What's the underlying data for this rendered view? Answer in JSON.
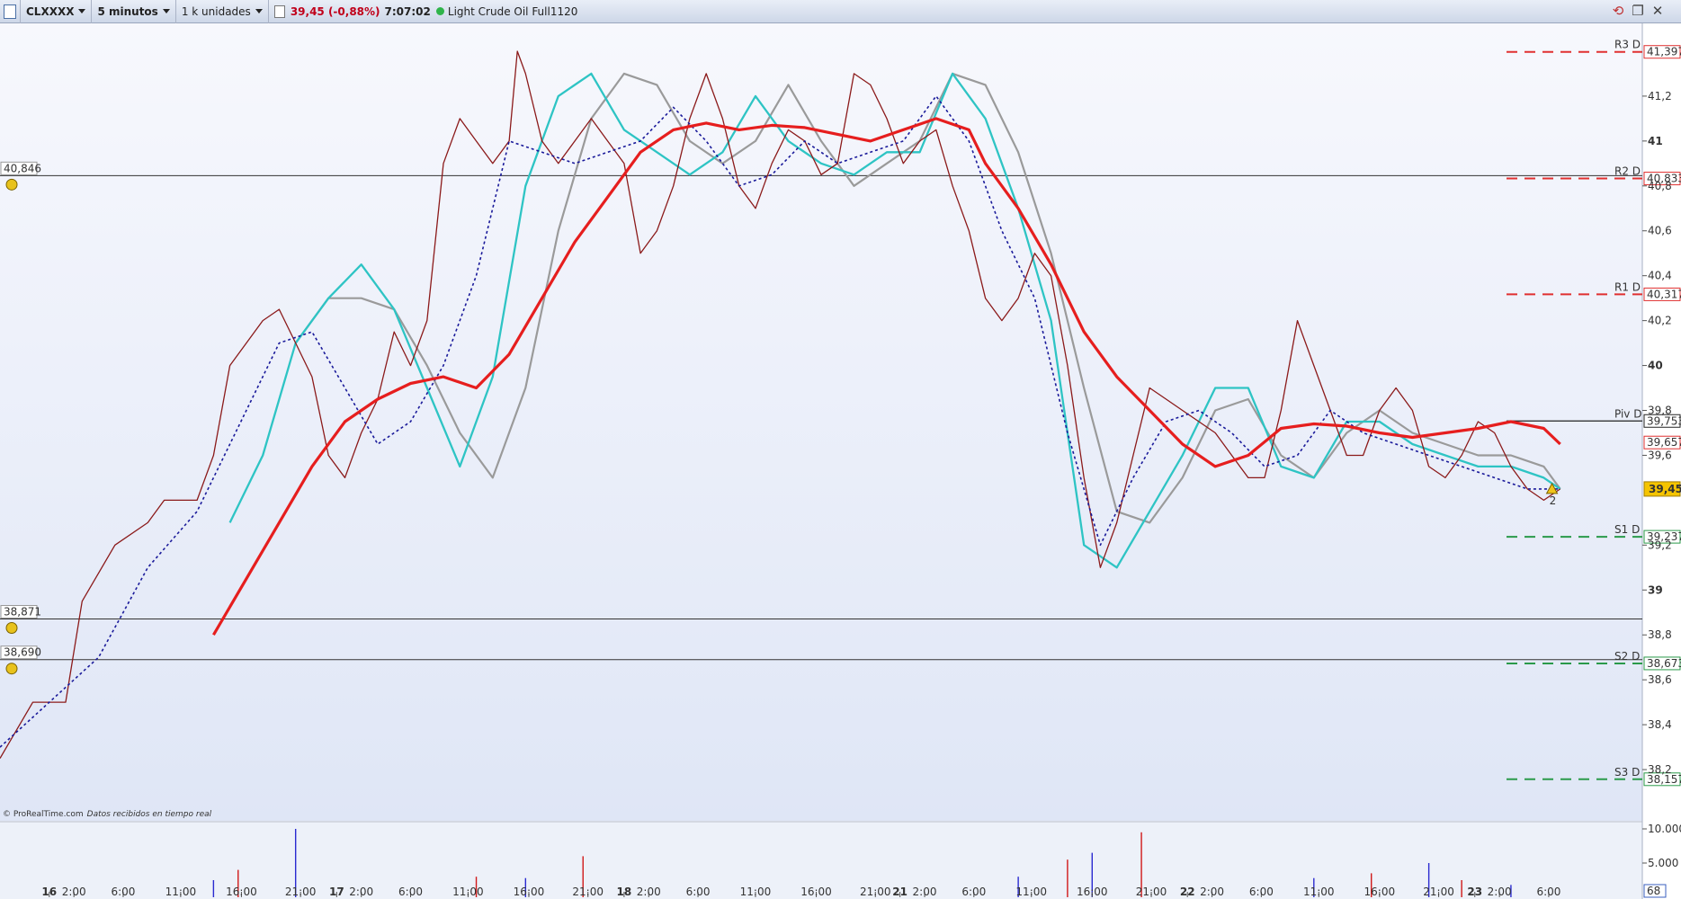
{
  "toolbar": {
    "symbol": "CLXXXX",
    "timeframe": "5 minutos",
    "units": "1 k unidades",
    "last_price": "39,45 (-0,88%)",
    "time": "7:07:02",
    "instrument": "Light Crude Oil Full1120"
  },
  "colors": {
    "price_up": "#3a9a3a",
    "price_down": "#8b1a1a",
    "ma_long": "#e61e1e",
    "cyan_line": "#2ec4c4",
    "gray_line": "#9a9a9a",
    "blue_dotted": "#1a1a9a",
    "resistance": "#e03030",
    "support": "#2a9a4a",
    "last_price_bg": "#f5c400"
  },
  "chart_data": {
    "type": "line",
    "title": "",
    "xlabel": "",
    "ylabel": "",
    "ylim": [
      38.0,
      41.5
    ],
    "x_ticks": [
      {
        "label": "16",
        "bold": true,
        "x": 0.03
      },
      {
        "label": "2:00",
        "x": 0.045
      },
      {
        "label": "6:00",
        "x": 0.075
      },
      {
        "label": "11:00",
        "x": 0.11
      },
      {
        "label": "16:00",
        "x": 0.147
      },
      {
        "label": "21:00",
        "x": 0.183
      },
      {
        "label": "17",
        "bold": true,
        "x": 0.205
      },
      {
        "label": "2:00",
        "x": 0.22
      },
      {
        "label": "6:00",
        "x": 0.25
      },
      {
        "label": "11:00",
        "x": 0.285
      },
      {
        "label": "16:00",
        "x": 0.322
      },
      {
        "label": "21:00",
        "x": 0.358
      },
      {
        "label": "18",
        "bold": true,
        "x": 0.38
      },
      {
        "label": "2:00",
        "x": 0.395
      },
      {
        "label": "6:00",
        "x": 0.425
      },
      {
        "label": "11:00",
        "x": 0.46
      },
      {
        "label": "16:00",
        "x": 0.497
      },
      {
        "label": "21:00",
        "x": 0.533
      },
      {
        "label": "21",
        "bold": true,
        "x": 0.548
      },
      {
        "label": "2:00",
        "x": 0.563
      },
      {
        "label": "6:00",
        "x": 0.593
      },
      {
        "label": "11:00",
        "x": 0.628
      },
      {
        "label": "16:00",
        "x": 0.665
      },
      {
        "label": "21:00",
        "x": 0.701
      },
      {
        "label": "22",
        "bold": true,
        "x": 0.723
      },
      {
        "label": "2:00",
        "x": 0.738
      },
      {
        "label": "6:00",
        "x": 0.768
      },
      {
        "label": "11:00",
        "x": 0.803
      },
      {
        "label": "16:00",
        "x": 0.84
      },
      {
        "label": "21:00",
        "x": 0.876
      },
      {
        "label": "23",
        "bold": true,
        "x": 0.898
      },
      {
        "label": "2:00",
        "x": 0.913
      },
      {
        "label": "6:00",
        "x": 0.943
      }
    ],
    "y_ticks": [
      {
        "label": "41,2",
        "v": 41.2
      },
      {
        "label": "41",
        "v": 41.0,
        "bold": true
      },
      {
        "label": "40,8",
        "v": 40.8
      },
      {
        "label": "40,6",
        "v": 40.6
      },
      {
        "label": "40,4",
        "v": 40.4
      },
      {
        "label": "40,2",
        "v": 40.2
      },
      {
        "label": "40",
        "v": 40.0,
        "bold": true
      },
      {
        "label": "39,8",
        "v": 39.8
      },
      {
        "label": "39,6",
        "v": 39.6
      },
      {
        "label": "39,2",
        "v": 39.2
      },
      {
        "label": "39",
        "v": 39.0,
        "bold": true
      },
      {
        "label": "38,8",
        "v": 38.8
      },
      {
        "label": "38,6",
        "v": 38.6
      },
      {
        "label": "38,4",
        "v": 38.4
      },
      {
        "label": "38,2",
        "v": 38.2
      }
    ],
    "pivot_levels": [
      {
        "name": "R3 D",
        "value": 41.397,
        "label": "41,397",
        "kind": "resistance"
      },
      {
        "name": "R2 D",
        "value": 40.833,
        "label": "40,833",
        "kind": "resistance"
      },
      {
        "name": "R1 D",
        "value": 40.317,
        "label": "40,317",
        "kind": "resistance"
      },
      {
        "name": "Piv D",
        "value": 39.753,
        "label": "39,753",
        "kind": "pivot"
      },
      {
        "name": "S1 D",
        "value": 39.237,
        "label": "39,237",
        "kind": "support"
      },
      {
        "name": "S2 D",
        "value": 38.673,
        "label": "38,673",
        "kind": "support"
      },
      {
        "name": "S3 D",
        "value": 38.157,
        "label": "38,157",
        "kind": "support"
      }
    ],
    "extra_price_label": {
      "value": 39.657,
      "label": "39,657"
    },
    "last_price": {
      "value": 39.45,
      "label": "39,45"
    },
    "horizontal_lines": [
      {
        "value": 40.846,
        "label": "40,846"
      },
      {
        "value": 38.871,
        "label": "38,871"
      },
      {
        "value": 38.69,
        "label": "38,690"
      }
    ],
    "series": [
      {
        "name": "price",
        "x": [
          0,
          0.02,
          0.04,
          0.05,
          0.07,
          0.09,
          0.1,
          0.12,
          0.13,
          0.14,
          0.15,
          0.16,
          0.17,
          0.18,
          0.19,
          0.2,
          0.21,
          0.22,
          0.23,
          0.24,
          0.25,
          0.26,
          0.27,
          0.28,
          0.29,
          0.3,
          0.31,
          0.315,
          0.32,
          0.33,
          0.34,
          0.35,
          0.36,
          0.37,
          0.38,
          0.39,
          0.4,
          0.41,
          0.42,
          0.43,
          0.44,
          0.45,
          0.46,
          0.47,
          0.48,
          0.49,
          0.5,
          0.51,
          0.52,
          0.53,
          0.54,
          0.55,
          0.56,
          0.57,
          0.58,
          0.59,
          0.6,
          0.61,
          0.62,
          0.63,
          0.64,
          0.65,
          0.66,
          0.67,
          0.68,
          0.69,
          0.7,
          0.71,
          0.72,
          0.73,
          0.74,
          0.75,
          0.76,
          0.77,
          0.78,
          0.79,
          0.8,
          0.81,
          0.82,
          0.83,
          0.84,
          0.85,
          0.86,
          0.87,
          0.88,
          0.89,
          0.9,
          0.91,
          0.92,
          0.93,
          0.94,
          0.95
        ],
        "values": [
          38.25,
          38.5,
          38.5,
          38.95,
          39.2,
          39.3,
          39.4,
          39.4,
          39.6,
          40.0,
          40.1,
          40.2,
          40.25,
          40.1,
          39.95,
          39.6,
          39.5,
          39.7,
          39.85,
          40.15,
          40.0,
          40.2,
          40.9,
          41.1,
          41.0,
          40.9,
          41.0,
          41.4,
          41.3,
          41.0,
          40.9,
          41.0,
          41.1,
          41.0,
          40.9,
          40.5,
          40.6,
          40.8,
          41.1,
          41.3,
          41.1,
          40.8,
          40.7,
          40.9,
          41.05,
          41.0,
          40.85,
          40.9,
          41.3,
          41.25,
          41.1,
          40.9,
          41.0,
          41.05,
          40.8,
          40.6,
          40.3,
          40.2,
          40.3,
          40.5,
          40.4,
          40.0,
          39.5,
          39.1,
          39.3,
          39.6,
          39.9,
          39.85,
          39.8,
          39.75,
          39.7,
          39.6,
          39.5,
          39.5,
          39.8,
          40.2,
          40.0,
          39.8,
          39.6,
          39.6,
          39.8,
          39.9,
          39.8,
          39.55,
          39.5,
          39.6,
          39.75,
          39.7,
          39.55,
          39.45,
          39.4,
          39.45
        ]
      },
      {
        "name": "ma_long",
        "x": [
          0.13,
          0.15,
          0.17,
          0.19,
          0.21,
          0.23,
          0.25,
          0.27,
          0.29,
          0.31,
          0.33,
          0.35,
          0.37,
          0.39,
          0.41,
          0.43,
          0.45,
          0.47,
          0.49,
          0.51,
          0.53,
          0.55,
          0.57,
          0.59,
          0.6,
          0.62,
          0.64,
          0.66,
          0.68,
          0.7,
          0.72,
          0.74,
          0.76,
          0.78,
          0.8,
          0.82,
          0.84,
          0.86,
          0.88,
          0.9,
          0.92,
          0.94,
          0.95
        ],
        "values": [
          38.8,
          39.05,
          39.3,
          39.55,
          39.75,
          39.85,
          39.92,
          39.95,
          39.9,
          40.05,
          40.3,
          40.55,
          40.75,
          40.95,
          41.05,
          41.08,
          41.05,
          41.07,
          41.06,
          41.03,
          41.0,
          41.05,
          41.1,
          41.05,
          40.9,
          40.7,
          40.45,
          40.15,
          39.95,
          39.8,
          39.65,
          39.55,
          39.6,
          39.72,
          39.74,
          39.73,
          39.7,
          39.68,
          39.7,
          39.72,
          39.75,
          39.72,
          39.65
        ]
      },
      {
        "name": "cyan",
        "x": [
          0.14,
          0.16,
          0.18,
          0.2,
          0.22,
          0.24,
          0.26,
          0.28,
          0.3,
          0.32,
          0.34,
          0.36,
          0.38,
          0.4,
          0.42,
          0.44,
          0.46,
          0.48,
          0.5,
          0.52,
          0.54,
          0.56,
          0.58,
          0.6,
          0.62,
          0.64,
          0.66,
          0.68,
          0.7,
          0.72,
          0.74,
          0.76,
          0.78,
          0.8,
          0.82,
          0.84,
          0.86,
          0.88,
          0.9,
          0.92,
          0.94,
          0.95
        ],
        "values": [
          39.3,
          39.6,
          40.1,
          40.3,
          40.45,
          40.25,
          39.9,
          39.55,
          39.95,
          40.8,
          41.2,
          41.3,
          41.05,
          40.95,
          40.85,
          40.95,
          41.2,
          41.0,
          40.9,
          40.85,
          40.95,
          40.95,
          41.3,
          41.1,
          40.7,
          40.2,
          39.2,
          39.1,
          39.35,
          39.6,
          39.9,
          39.9,
          39.55,
          39.5,
          39.75,
          39.75,
          39.65,
          39.6,
          39.55,
          39.55,
          39.5,
          39.45
        ]
      },
      {
        "name": "gray",
        "x": [
          0.18,
          0.2,
          0.22,
          0.24,
          0.26,
          0.28,
          0.3,
          0.32,
          0.34,
          0.36,
          0.38,
          0.4,
          0.42,
          0.44,
          0.46,
          0.48,
          0.5,
          0.52,
          0.54,
          0.56,
          0.58,
          0.6,
          0.62,
          0.64,
          0.66,
          0.68,
          0.7,
          0.72,
          0.74,
          0.76,
          0.78,
          0.8,
          0.82,
          0.84,
          0.86,
          0.88,
          0.9,
          0.92,
          0.94,
          0.95
        ],
        "values": [
          40.1,
          40.3,
          40.3,
          40.25,
          40.0,
          39.7,
          39.5,
          39.9,
          40.6,
          41.1,
          41.3,
          41.25,
          41.0,
          40.9,
          41.0,
          41.25,
          41.0,
          40.8,
          40.9,
          41.0,
          41.3,
          41.25,
          40.95,
          40.5,
          39.9,
          39.35,
          39.3,
          39.5,
          39.8,
          39.85,
          39.6,
          39.5,
          39.7,
          39.8,
          39.7,
          39.65,
          39.6,
          39.6,
          39.55,
          39.45
        ]
      },
      {
        "name": "blue_dotted",
        "x": [
          0,
          0.03,
          0.06,
          0.09,
          0.12,
          0.15,
          0.17,
          0.19,
          0.21,
          0.23,
          0.25,
          0.27,
          0.29,
          0.31,
          0.33,
          0.35,
          0.37,
          0.39,
          0.41,
          0.43,
          0.45,
          0.47,
          0.49,
          0.51,
          0.53,
          0.55,
          0.57,
          0.59,
          0.61,
          0.63,
          0.65,
          0.67,
          0.69,
          0.71,
          0.73,
          0.75,
          0.77,
          0.79,
          0.81,
          0.83,
          0.85,
          0.87,
          0.89,
          0.91,
          0.93,
          0.95
        ],
        "values": [
          38.3,
          38.5,
          38.7,
          39.1,
          39.35,
          39.8,
          40.1,
          40.15,
          39.9,
          39.65,
          39.75,
          40.0,
          40.4,
          41.0,
          40.95,
          40.9,
          40.95,
          41.0,
          41.15,
          41.0,
          40.8,
          40.85,
          41.0,
          40.9,
          40.95,
          41.0,
          41.2,
          41.0,
          40.6,
          40.3,
          39.7,
          39.2,
          39.5,
          39.75,
          39.8,
          39.7,
          39.55,
          39.6,
          39.8,
          39.7,
          39.65,
          39.6,
          39.55,
          39.5,
          39.45,
          39.45
        ]
      }
    ],
    "volume": {
      "y_ticks": [
        {
          "label": "10.000",
          "v": 10000
        },
        {
          "label": "5.000",
          "v": 5000
        }
      ],
      "counter_label": "68",
      "spikes": [
        {
          "x": 0.13,
          "v": 2500
        },
        {
          "x": 0.145,
          "v": 4000
        },
        {
          "x": 0.18,
          "v": 10000
        },
        {
          "x": 0.29,
          "v": 3000
        },
        {
          "x": 0.32,
          "v": 2800
        },
        {
          "x": 0.355,
          "v": 6000
        },
        {
          "x": 0.62,
          "v": 3000
        },
        {
          "x": 0.65,
          "v": 5500
        },
        {
          "x": 0.665,
          "v": 6500
        },
        {
          "x": 0.695,
          "v": 9500
        },
        {
          "x": 0.8,
          "v": 2800
        },
        {
          "x": 0.835,
          "v": 3500
        },
        {
          "x": 0.87,
          "v": 5000
        },
        {
          "x": 0.89,
          "v": 2500
        },
        {
          "x": 0.92,
          "v": 1800
        }
      ]
    },
    "grid": false,
    "legend": "none"
  },
  "footer": {
    "copyright": "© ProRealTime.com",
    "realtime": "Datos recibidos en tiempo real"
  },
  "annotations": {
    "alert_marker_count": "2"
  }
}
